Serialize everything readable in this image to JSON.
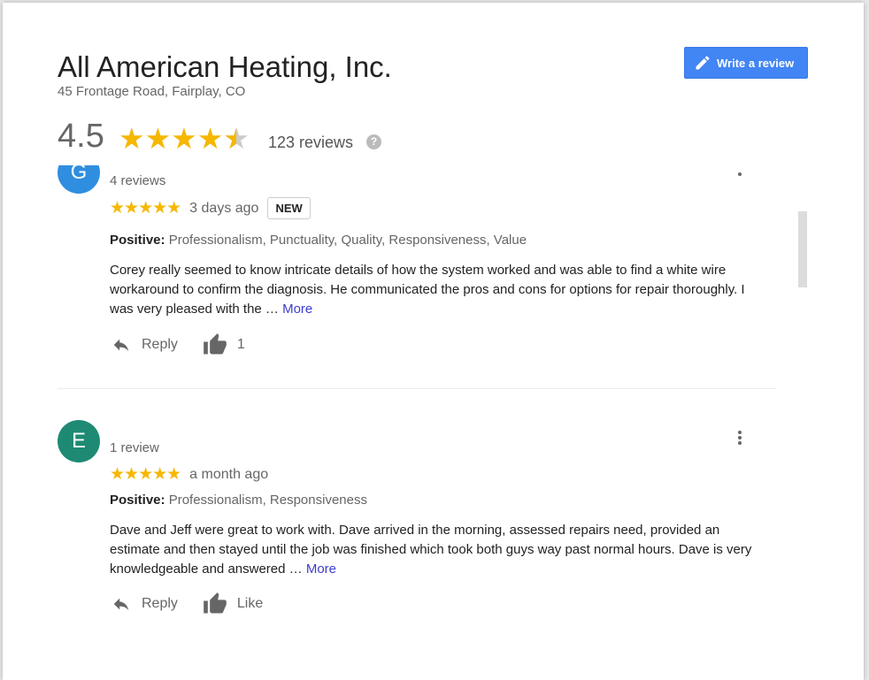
{
  "header": {
    "business_name": "All American Heating, Inc.",
    "address": "45 Frontage Road, Fairplay, CO",
    "write_review_label": "Write a review",
    "rating": "4.5",
    "rating_value": 4.5,
    "review_count_label": "123 reviews",
    "help_glyph": "?"
  },
  "reviews": [
    {
      "avatar_letter": "G",
      "avatar_color": "#2f8ee0",
      "author_reviews": "4 reviews",
      "stars": "★★★★★",
      "time_ago": "3 days ago",
      "badge": "NEW",
      "positive_label": "Positive:",
      "positive_values": "Professionalism, Punctuality, Quality, Responsiveness, Value",
      "text": "Corey really seemed to know intricate details of how the system worked and was able to find a white wire workaround to confirm the diagnosis.  He communicated the pros and cons for options for repair thoroughly.  I was very pleased with the … ",
      "more_label": "More",
      "reply_label": "Reply",
      "like_label": "1"
    },
    {
      "avatar_letter": "E",
      "avatar_color": "#1e8a73",
      "author_reviews": "1 review",
      "stars": "★★★★★",
      "time_ago": "a month ago",
      "positive_label": "Positive:",
      "positive_values": "Professionalism, Responsiveness",
      "text": "Dave and Jeff were great to work with. Dave arrived in the morning, assessed repairs need, provided an estimate and then stayed until the job was finished which took both guys way past normal hours. Dave is very knowledgeable and answered … ",
      "more_label": "More",
      "reply_label": "Reply",
      "like_label": "Like"
    }
  ],
  "colors": {
    "accent_button": "#4285f4",
    "star": "#f6b703",
    "link": "#3c3cce"
  },
  "icons": [
    "pencil-icon",
    "star-icon",
    "help-icon",
    "reply-icon",
    "thumbs-up-icon",
    "more-vert-icon"
  ]
}
